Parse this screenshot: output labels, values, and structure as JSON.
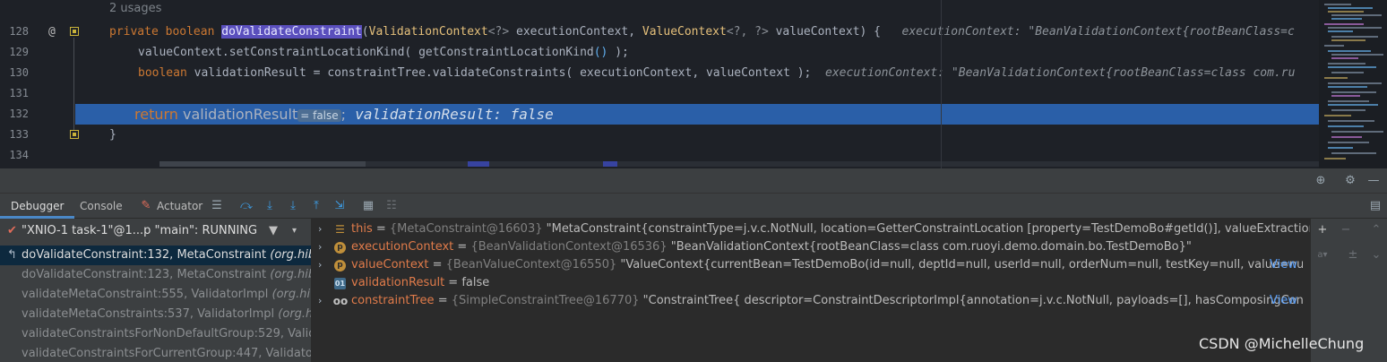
{
  "editor": {
    "usages": "2 usages",
    "line_numbers": [
      "128",
      "129",
      "130",
      "131",
      "132",
      "133",
      "134"
    ],
    "at_marker": "@",
    "line128": {
      "kw_private": "private",
      "kw_boolean": "boolean",
      "method": "doValidateConstraint",
      "open": "(",
      "type1": "ValidationContext",
      "gen1": "<?>",
      "param1": " executionContext, ",
      "type2": "ValueContext",
      "gen2": "<?, ?>",
      "param2": " valueContext) {",
      "inlay": "executionContext: \"BeanValidationContext{rootBeanClass=c"
    },
    "line129": {
      "text": "valueContext.setConstraintLocationKind( getConstraintLocationKind",
      "call": "()",
      "end": " );"
    },
    "line130": {
      "kw": "boolean",
      "text": " validationResult = constraintTree.validateConstraints( executionContext, valueContext );",
      "inlay": "executionContext: \"BeanValidationContext{rootBeanClass=class com.ru"
    },
    "line132": {
      "kw": "return",
      "text": " validationResult",
      "inline_value": "= false",
      "end": ";",
      "inlay": "validationResult: false"
    },
    "line133": {
      "text": "}"
    }
  },
  "toolbar": {
    "target_icon": "crosshair-icon",
    "settings_icon": "gear-icon",
    "hide_icon": "minus-icon"
  },
  "tabs": {
    "debugger": "Debugger",
    "console": "Console",
    "actuator": "Actuator"
  },
  "frames": {
    "thread_label": "\"XNIO-1 task-1\"@1...p \"main\": RUNNING",
    "items": [
      {
        "method": "doValidateConstraint:132, MetaConstraint ",
        "pkg": "(org.hibe"
      },
      {
        "method": "doValidateConstraint:123, MetaConstraint ",
        "pkg": "(org.hiberna"
      },
      {
        "method": "validateMetaConstraint:555, ValidatorImpl ",
        "pkg": "(org.hi"
      },
      {
        "method": "validateMetaConstraints:537, ValidatorImpl ",
        "pkg": "(org.hiber"
      },
      {
        "method": "validateConstraintsForNonDefaultGroup:529, Validat",
        "pkg": ""
      },
      {
        "method": "validateConstraintsForCurrentGroup:447, ValidatorIm",
        "pkg": ""
      }
    ]
  },
  "variables": [
    {
      "name": "this",
      "eq": " = ",
      "ref": "{MetaConstraint@16603}",
      "value": " \"MetaConstraint{constraintType=j.v.c.NotNull, location=GetterConstraintLocation [property=TestDemoBo#getId()], valueExtractionPath=null}\"",
      "view": ""
    },
    {
      "name": "executionContext",
      "eq": " = ",
      "ref": "{BeanValidationContext@16536}",
      "value": " \"BeanValidationContext{rootBeanClass=class com.ruoyi.demo.domain.bo.TestDemoBo}\"",
      "view": ""
    },
    {
      "name": "valueContext",
      "eq": " = ",
      "ref": "{BeanValueContext@16550}",
      "value": " \"ValueContext{currentBean=TestDemoBo(id=null, deptId=null, userId=null, orderNum=null, testKey=null, value=null), pro...",
      "view": " View"
    },
    {
      "name": "validationResult",
      "eq": " = ",
      "ref": "",
      "value": "false",
      "view": ""
    },
    {
      "name": "constraintTree",
      "eq": " = ",
      "ref": "{SimpleConstraintTree@16770}",
      "value": " \"ConstraintTree{ descriptor=ConstraintDescriptorImpl{annotation=j.v.c.NotNull, payloads=[], hasComposingConstraint...",
      "view": " View"
    }
  ],
  "watermark": "CSDN @MichelleChung",
  "colors": {
    "execution_line": "#2a5fa8",
    "method_highlight": "#5a4fbd",
    "variable_name": "#e07b4a",
    "link": "#589df6"
  }
}
